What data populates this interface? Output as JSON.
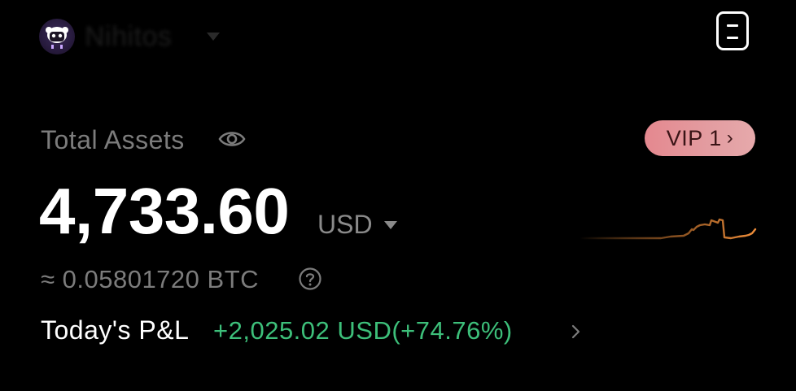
{
  "header": {
    "username": "Nihitos",
    "avatar_icon": "sheep-avatar-icon",
    "menu_icon": "menu-icon"
  },
  "assets": {
    "label": "Total Assets",
    "visibility_icon": "eye-icon",
    "amount": "4,733.60",
    "currency": "USD",
    "btc_equivalent": "≈ 0.05801720 BTC",
    "help_icon": "question-circle-icon"
  },
  "vip": {
    "label": "VIP 1",
    "chevron": "›"
  },
  "pnl": {
    "label": "Today's P&L",
    "value": "+2,025.02 USD(+74.76%)",
    "chevron_icon": "chevron-right-icon"
  },
  "colors": {
    "background": "#000000",
    "positive": "#3dbf7a",
    "vip_badge": "#e4888f",
    "sparkline": "#e08a3a",
    "muted_text": "#7c7c7c"
  }
}
